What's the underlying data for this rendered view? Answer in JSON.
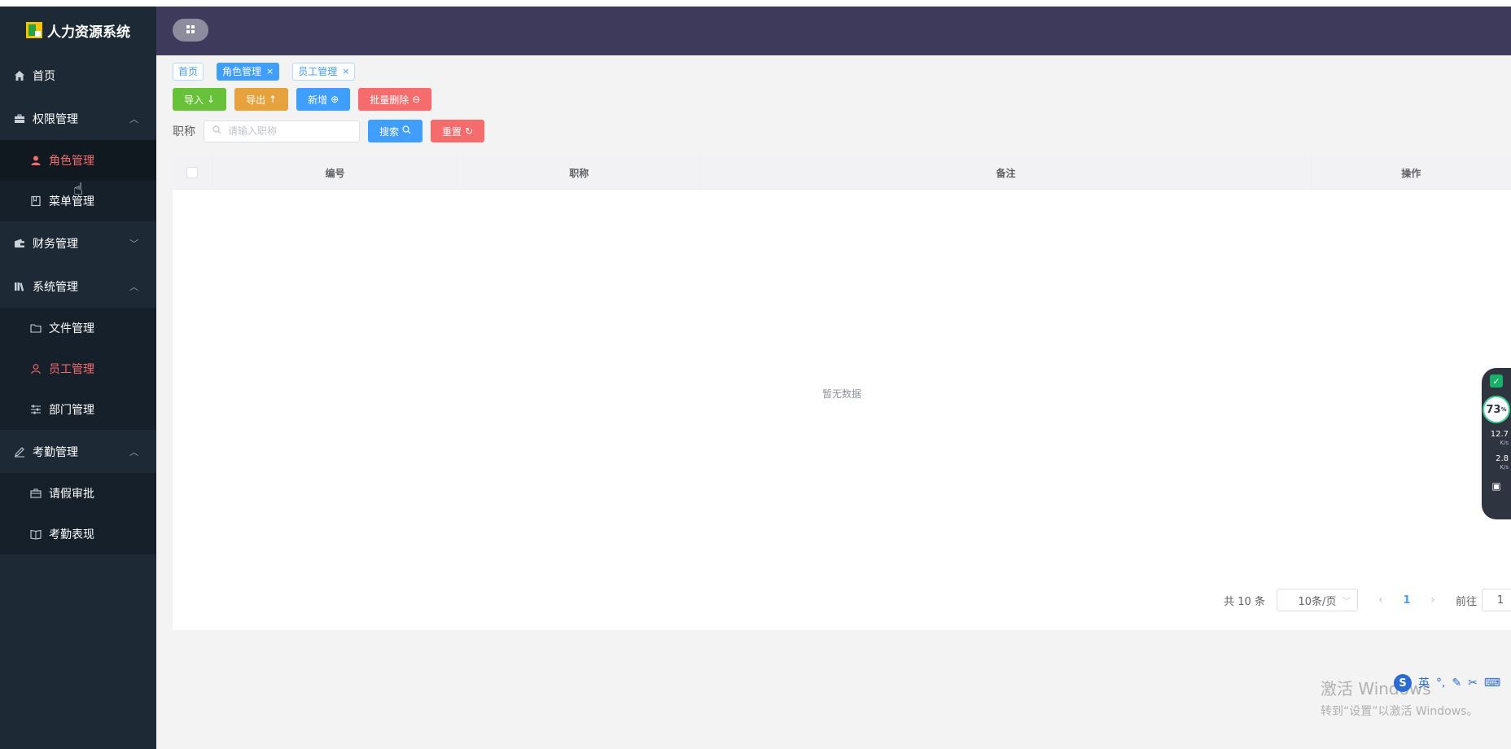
{
  "app": {
    "title": "人力资源系统"
  },
  "sidebar": {
    "items": [
      {
        "label": "首页",
        "icon": "home-icon"
      },
      {
        "label": "权限管理",
        "icon": "briefcase-icon",
        "expanded": true,
        "children": [
          {
            "label": "角色管理",
            "icon": "user-icon",
            "active": true
          },
          {
            "label": "菜单管理",
            "icon": "document-icon"
          }
        ]
      },
      {
        "label": "财务管理",
        "icon": "wallet-icon",
        "expanded": false
      },
      {
        "label": "系统管理",
        "icon": "library-icon",
        "expanded": true,
        "children": [
          {
            "label": "文件管理",
            "icon": "folder-icon"
          },
          {
            "label": "员工管理",
            "icon": "user-outline-icon",
            "active": true
          },
          {
            "label": "部门管理",
            "icon": "sliders-icon"
          }
        ]
      },
      {
        "label": "考勤管理",
        "icon": "edit-icon",
        "expanded": true,
        "children": [
          {
            "label": "请假审批",
            "icon": "suitcase-icon"
          },
          {
            "label": "考勤表现",
            "icon": "book-icon"
          }
        ]
      }
    ]
  },
  "tabs": [
    {
      "label": "首页",
      "active": false,
      "closable": false
    },
    {
      "label": "角色管理",
      "active": true,
      "closable": true
    },
    {
      "label": "员工管理",
      "active": false,
      "closable": true
    }
  ],
  "toolbar": {
    "import_label": "导入",
    "export_label": "导出",
    "add_label": "新增",
    "batch_delete_label": "批量删除"
  },
  "search": {
    "label": "职称",
    "placeholder": "请输入职称",
    "value": "",
    "search_label": "搜索",
    "reset_label": "重置"
  },
  "table": {
    "columns": [
      "编号",
      "职称",
      "备注",
      "操作"
    ],
    "rows": [],
    "empty_text": "暂无数据"
  },
  "pagination": {
    "total_text": "共 10 条",
    "page_size": "10条/页",
    "current_page": "1",
    "goto_label": "前往",
    "goto_value": "1"
  },
  "monitor": {
    "percent": "73",
    "percent_unit": "%",
    "up_speed": "12.7",
    "up_unit": "K/s",
    "down_speed": "2.8",
    "down_unit": "K/s"
  },
  "ime": {
    "logo": "S",
    "mode": "英"
  },
  "watermark": {
    "line1": "激活 Windows",
    "line2": "转到“设置”以激活 Windows。"
  },
  "colors": {
    "sidebar_bg": "#1d2a36",
    "header_bg": "#3d3a5c",
    "primary": "#409eff",
    "success": "#67c23a",
    "warning": "#e6a23c",
    "danger": "#f56c6c",
    "active_menu": "#f56c6c"
  }
}
